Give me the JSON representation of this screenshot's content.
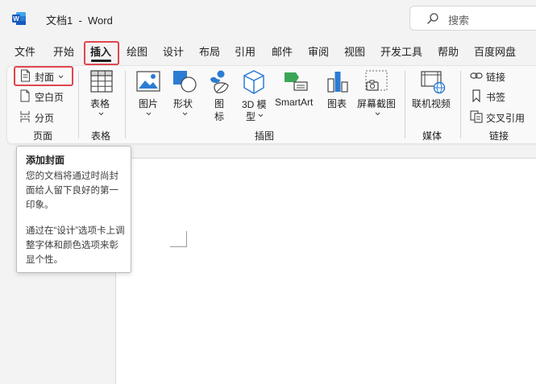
{
  "window": {
    "app_name": "Word",
    "title": "文档1  -  Word"
  },
  "search": {
    "placeholder": "搜索"
  },
  "menu": {
    "tabs": [
      "文件",
      "开始",
      "插入",
      "绘图",
      "设计",
      "布局",
      "引用",
      "邮件",
      "审阅",
      "视图",
      "开发工具",
      "帮助",
      "百度网盘"
    ],
    "active": "插入"
  },
  "ribbon": {
    "pages_group": {
      "label": "页面",
      "cover": "封面",
      "blank_page": "空白页",
      "page_break": "分页"
    },
    "table_group": {
      "label": "表格",
      "table": "表格"
    },
    "illustrations_group": {
      "label": "插图",
      "pictures": "图片",
      "shapes": "形状",
      "icons_line1": "图",
      "icons_line2": "标",
      "models_line1": "3D 模",
      "models_line2": "型",
      "smartart": "SmartArt",
      "chart": "图表",
      "screenshot": "屏幕截图"
    },
    "media_group": {
      "label": "媒体",
      "online_video": "联机视频"
    },
    "links_group": {
      "label": "链接",
      "link": "链接",
      "bookmark": "书签",
      "cross_reference": "交叉引用"
    }
  },
  "tooltip": {
    "title": "添加封面",
    "body1": "您的文档将通过时尚封面给人留下良好的第一印象。",
    "body2": "通过在“设计”选项卡上调整字体和颜色选项来彰显个性。"
  },
  "colors": {
    "highlight": "#e0464e",
    "word_blue": "#185abd",
    "icon_blue": "#2b7cd3"
  }
}
